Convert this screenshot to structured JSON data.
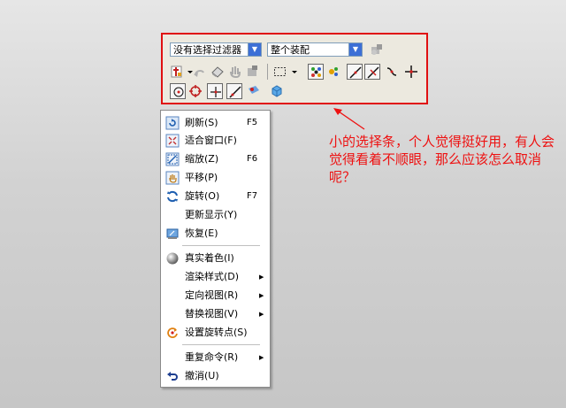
{
  "toolbar": {
    "filter_combo": "没有选择过滤器",
    "assembly_combo": "整个装配",
    "highlight_color": "#e01010"
  },
  "menu": {
    "items": [
      {
        "label": "刷新(S)",
        "key": "F5",
        "icon": "refresh-icon"
      },
      {
        "label": "适合窗口(F)",
        "key": "",
        "icon": "fit-window-icon"
      },
      {
        "label": "缩放(Z)",
        "key": "F6",
        "icon": "zoom-icon"
      },
      {
        "label": "平移(P)",
        "key": "",
        "icon": "pan-icon"
      },
      {
        "label": "旋转(O)",
        "key": "F7",
        "icon": "rotate-icon"
      },
      {
        "label": "更新显示(Y)",
        "key": "",
        "icon": ""
      },
      {
        "label": "恢复(E)",
        "key": "",
        "icon": "restore-icon"
      },
      {
        "label": "真实着色(I)",
        "key": "",
        "icon": "shading-sphere-icon"
      },
      {
        "label": "渲染样式(D)",
        "key": "",
        "icon": "",
        "submenu": true
      },
      {
        "label": "定向视图(R)",
        "key": "",
        "icon": "",
        "submenu": true
      },
      {
        "label": "替换视图(V)",
        "key": "",
        "icon": "",
        "submenu": true
      },
      {
        "label": "设置旋转点(S)",
        "key": "",
        "icon": "rotation-point-icon"
      },
      {
        "label": "重复命令(R)",
        "key": "",
        "icon": "",
        "submenu": true
      },
      {
        "label": "撤消(U)",
        "key": "",
        "icon": "undo-icon"
      }
    ]
  },
  "annotation": {
    "text": "小的选择条，个人觉得挺好用，有人会觉得看着不顺眼，那么应该怎么取消呢？",
    "color": "#ee1111"
  }
}
